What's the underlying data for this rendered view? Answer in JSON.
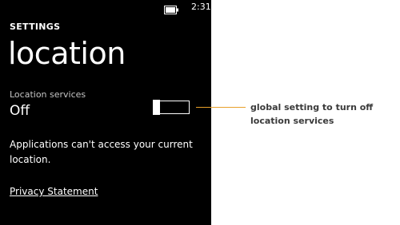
{
  "status_bar": {
    "time": "2:31",
    "battery_icon": "battery-icon"
  },
  "header": {
    "section": "SETTINGS",
    "title": "location"
  },
  "setting": {
    "label": "Location services",
    "value": "Off",
    "toggle_on": false
  },
  "description": "Applications can't access your current location.",
  "privacy_link": "Privacy Statement",
  "annotation": {
    "text": "global setting to turn off location services",
    "line_color": "#e8a02a"
  },
  "colors": {
    "phone_background": "#000000",
    "page_background": "#ffffff",
    "accent": "#e8a02a"
  }
}
